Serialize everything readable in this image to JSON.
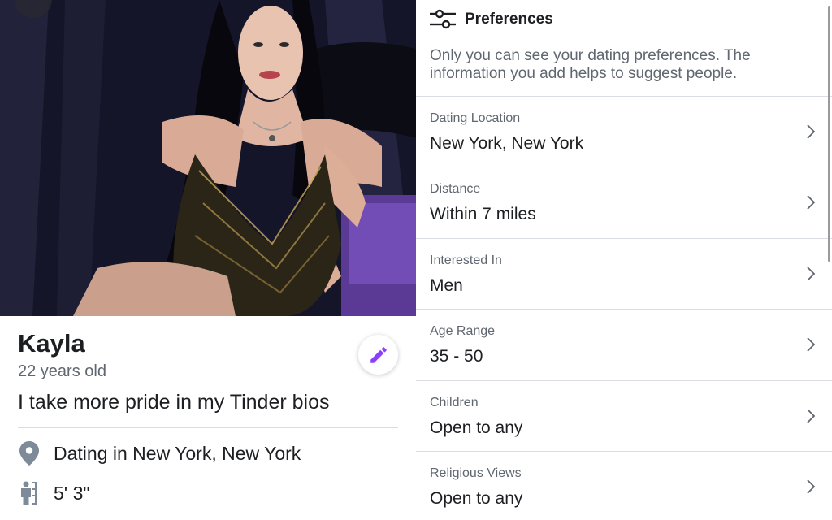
{
  "profile": {
    "name": "Kayla",
    "age": "22 years old",
    "bio": "I take more pride in my Tinder bios",
    "location": "Dating in New York, New York",
    "height": "5' 3\""
  },
  "preferences": {
    "title": "Preferences",
    "description": "Only you can see your dating preferences. The information you add helps to suggest people.",
    "items": [
      {
        "label": "Dating Location",
        "value": "New York, New York"
      },
      {
        "label": "Distance",
        "value": "Within 7 miles"
      },
      {
        "label": "Interested In",
        "value": "Men"
      },
      {
        "label": "Age Range",
        "value": "35 - 50"
      },
      {
        "label": "Children",
        "value": "Open to any"
      },
      {
        "label": "Religious Views",
        "value": "Open to any"
      }
    ]
  },
  "icons": {
    "edit": "pencil-icon",
    "location": "map-pin-icon",
    "height": "height-icon",
    "preferences": "sliders-icon",
    "chevron": "chevron-right-icon"
  },
  "colors": {
    "accent": "#8a3ffc",
    "text_primary": "#1c1e21",
    "text_secondary": "#606770",
    "divider": "#dadde1",
    "icon_gray": "#7f8a99"
  }
}
